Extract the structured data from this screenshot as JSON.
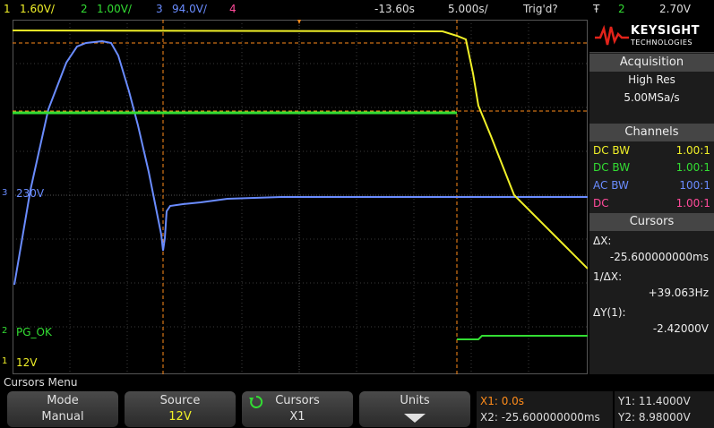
{
  "topbar": {
    "ch1_num": "1",
    "ch1_scale": "1.60V/",
    "ch2_num": "2",
    "ch2_scale": "1.00V/",
    "ch3_num": "3",
    "ch3_scale": "94.0V/",
    "ch4_num": "4",
    "time_offset": "-13.60s",
    "timebase": "5.000s/",
    "trigger_status": "Trig'd?",
    "trigger_icon": "Ŧ",
    "trigger_channel": "2",
    "trigger_level": "2.70V"
  },
  "screen": {
    "label_ch3": "230V",
    "label_ch2": "PG_OK",
    "label_ch1": "12V",
    "marker_ch3": "3",
    "marker_ch2": "2",
    "marker_ch1": "1"
  },
  "logo": {
    "name": "KEYSIGHT",
    "sub": "TECHNOLOGIES"
  },
  "acquisition": {
    "title": "Acquisition",
    "mode": "High Res",
    "rate": "5.00MSa/s"
  },
  "channels": {
    "title": "Channels",
    "rows": [
      {
        "coupling": "DC BW",
        "probe": "1.00:1",
        "color": "#f0f028"
      },
      {
        "coupling": "DC BW",
        "probe": "1.00:1",
        "color": "#33dd33"
      },
      {
        "coupling": "AC BW",
        "probe": "100:1",
        "color": "#6a8cff"
      },
      {
        "coupling": "DC",
        "probe": "1.00:1",
        "color": "#ff4a9a"
      }
    ]
  },
  "cursors_panel": {
    "title": "Cursors",
    "dx_label": "ΔX:",
    "dx_value": "-25.600000000ms",
    "inv_label": "1/ΔX:",
    "inv_value": "+39.063Hz",
    "dy_label": "ΔY(1):",
    "dy_value": "-2.42000V"
  },
  "menu": {
    "title": "Cursors Menu",
    "mode_label": "Mode",
    "mode_value": "Manual",
    "source_label": "Source",
    "source_value": "12V",
    "cursors_label": "Cursors",
    "cursors_value": "X1",
    "units_label": "Units"
  },
  "readout": {
    "x1": "X1: 0.0s",
    "x2": "X2: -25.600000000ms",
    "y1": "Y1: 11.4000V",
    "y2": "Y2: 8.98000V"
  },
  "colors": {
    "ch1": "#f0f028",
    "ch2": "#33dd33",
    "ch3": "#6a8cff",
    "ch4": "#ff4a9a",
    "cursor": "#ff8c1a"
  }
}
